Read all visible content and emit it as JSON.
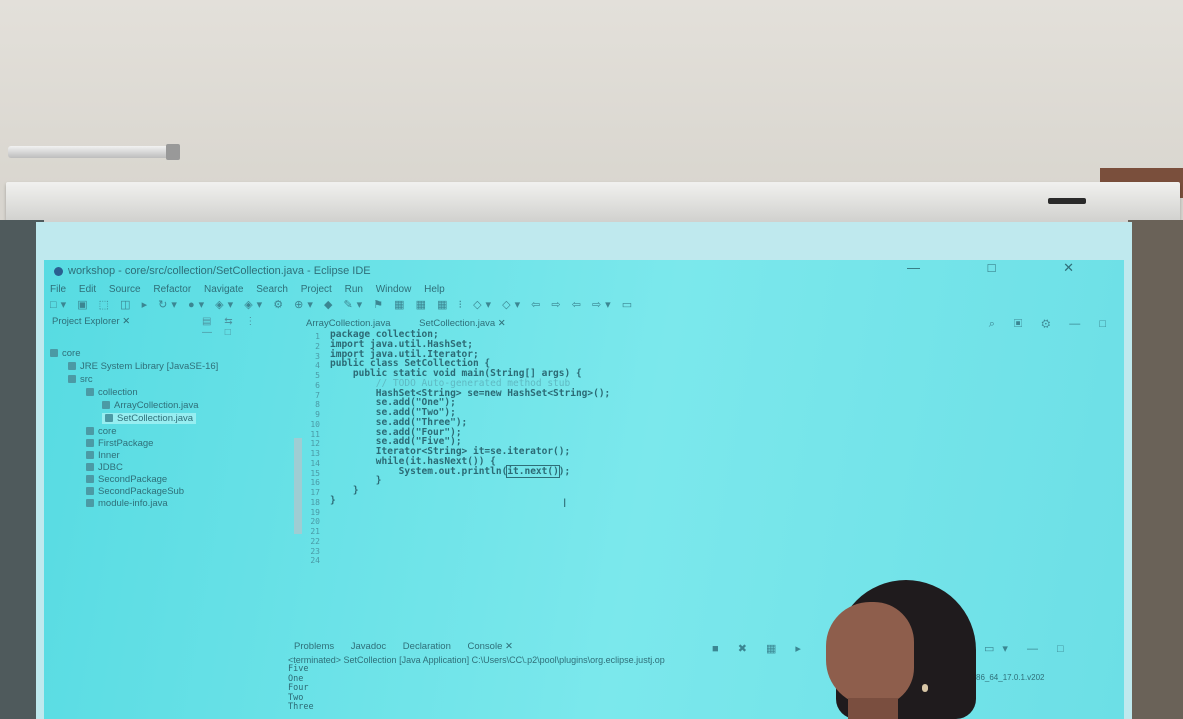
{
  "window": {
    "title": "workshop - core/src/collection/SetCollection.java - Eclipse IDE",
    "controls": "— □ ✕"
  },
  "menu": [
    "File",
    "Edit",
    "Source",
    "Refactor",
    "Navigate",
    "Search",
    "Project",
    "Run",
    "Window",
    "Help"
  ],
  "explorer": {
    "title": "Project Explorer ✕",
    "items": [
      {
        "label": "core",
        "indent": 0,
        "selected": false
      },
      {
        "label": "JRE System Library [JavaSE-16]",
        "indent": 1,
        "selected": false
      },
      {
        "label": "src",
        "indent": 1,
        "selected": false
      },
      {
        "label": "collection",
        "indent": 2,
        "selected": false
      },
      {
        "label": "ArrayCollection.java",
        "indent": 3,
        "selected": false
      },
      {
        "label": "SetCollection.java",
        "indent": 3,
        "selected": true
      },
      {
        "label": "core",
        "indent": 2,
        "selected": false
      },
      {
        "label": "FirstPackage",
        "indent": 2,
        "selected": false
      },
      {
        "label": "Inner",
        "indent": 2,
        "selected": false
      },
      {
        "label": "JDBC",
        "indent": 2,
        "selected": false
      },
      {
        "label": "SecondPackage",
        "indent": 2,
        "selected": false
      },
      {
        "label": "SecondPackageSub",
        "indent": 2,
        "selected": false
      },
      {
        "label": "module-info.java",
        "indent": 2,
        "selected": false
      }
    ]
  },
  "editor": {
    "tabs": [
      "ArrayCollection.java",
      "SetCollection.java ✕"
    ],
    "line_numbers": "1\n2\n3\n4\n5\n6\n7\n8\n9\n10\n11\n12\n13\n14\n15\n16\n17\n18\n19\n20\n21\n22\n23\n24",
    "code": {
      "l1": "package collection;",
      "l2": "",
      "l3": "import java.util.HashSet;",
      "l4": "import java.util.Iterator;",
      "l5": "",
      "l6": "public class SetCollection {",
      "l7": "",
      "l8": "    public static void main(String[] args) {",
      "l9": "        // TODO Auto-generated method stub",
      "l10": "        HashSet<String> se=new HashSet<String>();",
      "l11": "        se.add(\"One\");",
      "l12": "        se.add(\"Two\");",
      "l13": "        se.add(\"Three\");",
      "l14": "        se.add(\"Four\");",
      "l15": "        se.add(\"Five\");",
      "l16": "",
      "l17": "        Iterator<String> it=se.iterator();",
      "l18": "        while(it.hasNext()) {",
      "l19a": "            System.out.println(",
      "l19b": "it.next()",
      "l19c": ");",
      "l20": "        }",
      "l21": "    }",
      "l22": "",
      "l23": "}",
      "l24": ""
    }
  },
  "console": {
    "tabs": [
      "Problems",
      "Javadoc",
      "Declaration",
      "Console ✕"
    ],
    "terminated": "<terminated> SetCollection [Java Application] C:\\Users\\CC\\.p2\\pool\\plugins\\org.eclipse.justj.op",
    "terminated_tail": "x86_64_17.0.1.v202",
    "output": [
      "Five",
      "One",
      "Four",
      "Two",
      "Three"
    ]
  }
}
